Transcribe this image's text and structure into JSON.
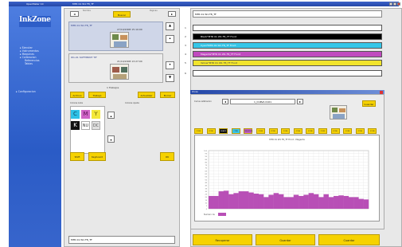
{
  "window": {
    "app_title": "OpenMeter 10",
    "doc_title": "MTR 01 W1 F8_TF"
  },
  "sidebar": {
    "logo": "InkZone",
    "items": [
      {
        "label": "Ejecutar"
      },
      {
        "label": "Instrumentos"
      },
      {
        "label": "Maquinas"
      },
      {
        "label": "Calibracion"
      },
      {
        "label": "Referencias"
      },
      {
        "label": "Tablas"
      },
      {
        "label": "Configuracion"
      }
    ]
  },
  "jobs": {
    "nombre_label": "Nombre",
    "paginas_label": "Paginas",
    "search_label": "Buscar",
    "list": [
      {
        "name": "MTR 01 W1 F8_TF",
        "date": "27/10/2008 15:10:00"
      },
      {
        "name": "W1-01 SOFTPRINT TIF",
        "date": "21/10/2008 13:27:00"
      }
    ]
  },
  "trabajos": {
    "heading": "1 Trabajos",
    "archivo_label": "Archivo",
    "trabajo_label": "Trabajo",
    "actualizar_label": "Actualizar",
    "borrar_label": "Borrar",
    "colores_label": "Colores Lista",
    "colores_ajuste_label": "Colores Ajuste",
    "colors": [
      {
        "code": "C",
        "bg": "#2fc1e6",
        "fg": "#0b4a66"
      },
      {
        "code": "M",
        "bg": "#cf64c6",
        "fg": "#5a1455"
      },
      {
        "code": "Y",
        "bg": "#f3e83a",
        "fg": "#6a6100"
      },
      {
        "code": "K",
        "bg": "#111111",
        "fg": "#ffffff"
      },
      {
        "code": "NU",
        "bg": "#ffffff",
        "fg": "#333333"
      },
      {
        "code": "DC",
        "bg": "#e0e0e0",
        "fg": "#555555"
      }
    ],
    "shift_label": "Shift",
    "keyboard_label": "Keyboard",
    "ok_label": "OK",
    "footer_name": "MTR 01 W1 F8_TF"
  },
  "separations": {
    "header": "MTR 01 W1 F8_TF",
    "rows": [
      {
        "num": "1",
        "label": "",
        "bg": "#ffffff",
        "fg": "#222222"
      },
      {
        "num": "2",
        "label": "Black*MTR 01 W1 F8_TF Front",
        "bg": "#000000",
        "fg": "#ffffff"
      },
      {
        "num": "3",
        "label": "Cyan*MTR 01 W1 F8_TF Front",
        "bg": "#35c6e8",
        "fg": "#ffffff"
      },
      {
        "num": "4",
        "label": "Magenta*MTR 01 W1 F8_TF Front",
        "bg": "#c04bbf",
        "fg": "#ffffff"
      },
      {
        "num": "5",
        "label": "Yellow*MTR 01 W1 F8_TF Front",
        "bg": "#f1e42c",
        "fg": "#444444"
      },
      {
        "num": "6",
        "label": "",
        "bg": "#ffffff",
        "fg": "#222222"
      }
    ]
  },
  "inkzone_window": {
    "title": "Zonas",
    "cur_calibration_label": "Curva calibracion",
    "cur_calibration_value": "1_CURVA 0101",
    "guardar_label": "Guardar",
    "tabs": [
      {
        "label": "ZONE",
        "color": "#f6d200"
      },
      {
        "label": "ZONE",
        "color": "#f6d200"
      },
      {
        "label": "BLACK",
        "color": "#111111"
      },
      {
        "label": "CYAN",
        "color": "#3ac7ea"
      },
      {
        "label": "MAGENTA",
        "color": "#c35ac3"
      },
      {
        "label": "ZONE",
        "color": "#f6d200"
      },
      {
        "label": "ZONE",
        "color": "#f6d200"
      },
      {
        "label": "ZONE",
        "color": "#f6d200"
      },
      {
        "label": "ZONE",
        "color": "#f6d200"
      },
      {
        "label": "ZONE",
        "color": "#f6d200"
      },
      {
        "label": "ZONE",
        "color": "#f6d200"
      },
      {
        "label": "ZONE",
        "color": "#f6d200"
      },
      {
        "label": "ZONE",
        "color": "#f6d200"
      },
      {
        "label": "ZONE",
        "color": "#f6d200"
      },
      {
        "label": "ZONE",
        "color": "#f6d200"
      }
    ],
    "legend_label": "Numero de"
  },
  "chart_data": {
    "type": "bar",
    "title": "MTR 01 W1 F8_TF Front - Magenta",
    "series": [
      {
        "color": "#b84fb6",
        "values": [
          22,
          22,
          30,
          31,
          25,
          27,
          30,
          30,
          28,
          26,
          25,
          20,
          24,
          27,
          25,
          20,
          20,
          24,
          22,
          24,
          27,
          25,
          20,
          25,
          20,
          22,
          23,
          22,
          20,
          20,
          17,
          16
        ]
      }
    ],
    "ylim": [
      0,
      100
    ],
    "yticks": [
      "100",
      "95",
      "90",
      "85",
      "80",
      "75",
      "70",
      "65",
      "60",
      "55",
      "50",
      "45",
      "40",
      "35",
      "30",
      "25",
      "20",
      "15",
      "10",
      "5",
      "0"
    ],
    "grid": true
  },
  "actions": {
    "recuperar_label": "Recuperar",
    "guardar_label": "Guardar",
    "cancelar_label": "Cuardar"
  },
  "colors": {
    "accent_yellow": "#f6d200",
    "sidebar_blue": "#3765cc",
    "title_blue": "#2447a8"
  }
}
